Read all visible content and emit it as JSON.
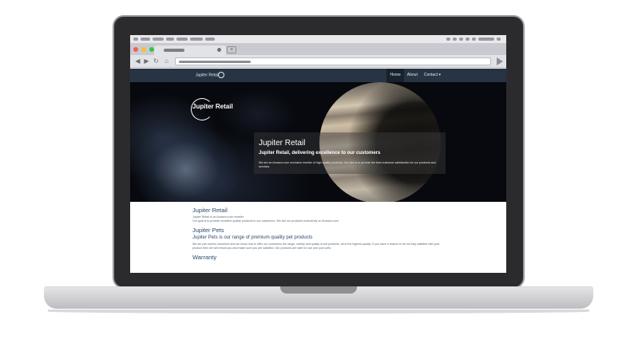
{
  "site": {
    "brand": "Jupiter Retail",
    "nav": [
      {
        "label": "Home",
        "active": true
      },
      {
        "label": "About",
        "active": false
      },
      {
        "label": "Contact ▾",
        "active": false
      }
    ]
  },
  "hero": {
    "logo": "Jupiter Retail",
    "title": "Jupiter Retail",
    "subtitle": "Jupiter Retail, delivering excellence to our customers",
    "text": "We are an Amazon.com exclusive reseller of high quality products. Our aim is to provide the best customer satisfaction for our products and services."
  },
  "sections": [
    {
      "heading": "Jupiter Retail",
      "lines": [
        "Jupiter Retail is an Amazon.com reseller",
        "Our goal is to provide excellent quality products to our customers. We sell our products exclusively on Amazon.com"
      ]
    },
    {
      "heading": "Jupiter Pets",
      "subheading": "Jupiter Pets is our range of premium quality pet products",
      "lines": [
        "We are pet owners ourselves and we know how to offer our customers the range, variety and quality of pet products, all of the highest quality. If you have a reason to be not fully satisfied with your product then we will refund you and make sure you are satisfied. Our products are safe for use and your pets."
      ]
    },
    {
      "heading": "Warranty"
    }
  ],
  "colors": {
    "nav_bg": "#273444",
    "heading": "#2d4a6b",
    "traffic_red": "#f25f58",
    "traffic_yellow": "#f7be33",
    "traffic_green": "#3ac24b"
  }
}
